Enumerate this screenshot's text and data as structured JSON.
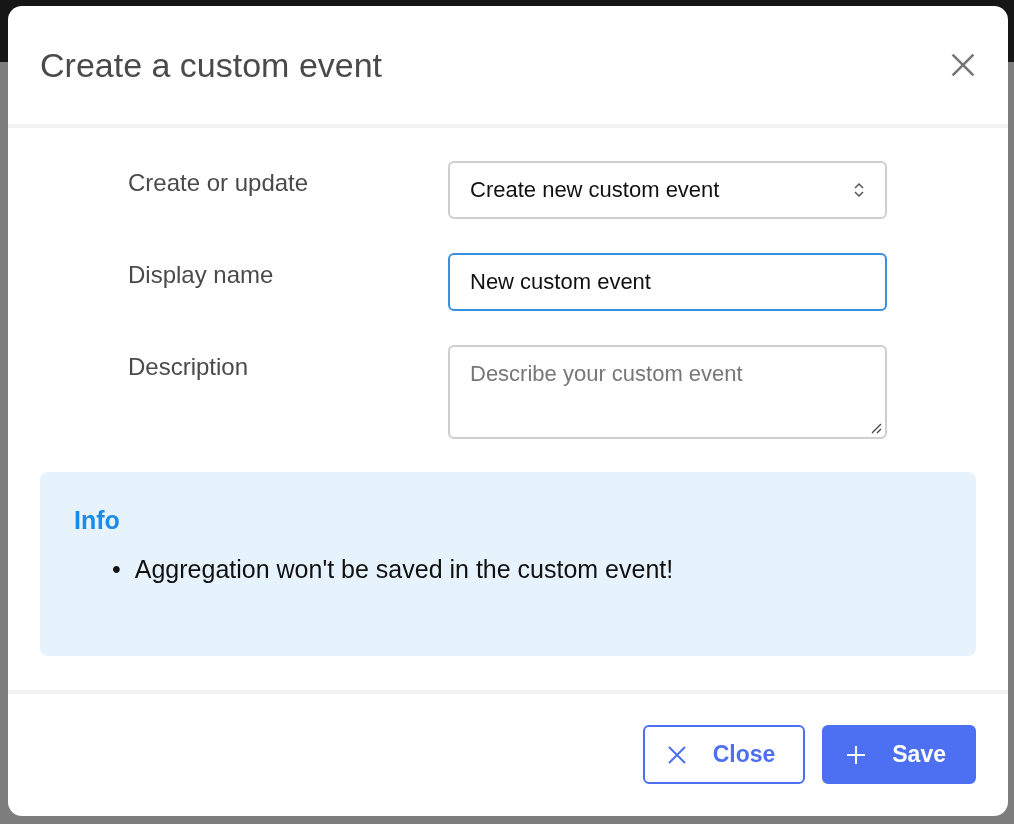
{
  "dialog": {
    "title": "Create a custom event",
    "fields": [
      {
        "kind": "select",
        "label": "Create or update",
        "value": "Create new custom event",
        "focused": false
      },
      {
        "kind": "input",
        "label": "Display name",
        "value": "New custom event",
        "focused": true
      },
      {
        "kind": "textarea",
        "label": "Description",
        "placeholder": "Describe your custom event",
        "focused": false
      }
    ],
    "info": {
      "title": "Info",
      "items": [
        {
          "bullet": "•",
          "text": "Aggregation won't be saved in the custom event!"
        }
      ]
    },
    "buttons": [
      {
        "kind": "secondary",
        "label": "Close"
      },
      {
        "kind": "primary",
        "label": "Save"
      }
    ]
  }
}
